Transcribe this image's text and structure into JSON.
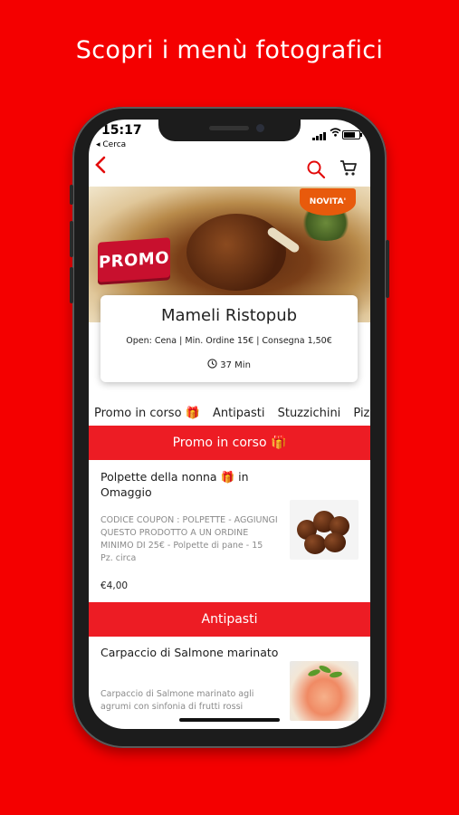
{
  "headline": "Scopri i menù fotografici",
  "status_bar": {
    "time": "15:17",
    "back_app": "◂ Cerca"
  },
  "restaurant": {
    "name": "Mameli Ristopub",
    "details": "Open: Cena | Min. Ordine 15€ | Consegna 1,50€",
    "delivery_time": "37 Min",
    "promo_badge": "PROMO",
    "new_badge": "NOVITA'"
  },
  "category_tabs": [
    "Promo in corso 🎁",
    "Antipasti",
    "Stuzzichini",
    "Pizz"
  ],
  "sections": [
    {
      "title": "Promo in corso 🎁",
      "items": [
        {
          "name": "Polpette della nonna 🎁 in Omaggio",
          "description": "CODICE COUPON : POLPETTE - AGGIUNGI QUESTO PRODOTTO A UN ORDINE MINIMO DI 25€ - Polpette di pane - 15 Pz. circa",
          "price": "€4,00"
        }
      ]
    },
    {
      "title": "Antipasti",
      "items": [
        {
          "name": "Carpaccio di Salmone marinato",
          "description": "Carpaccio di Salmone marinato agli agrumi con sinfonia di frutti rossi"
        }
      ]
    }
  ],
  "colors": {
    "background": "#f40000",
    "accent": "#ed1c24",
    "icon": "#e30b0b"
  },
  "icons": [
    "back-chevron-icon",
    "search-icon",
    "cart-icon",
    "clock-icon",
    "signal-icon",
    "wifi-icon",
    "battery-icon"
  ]
}
